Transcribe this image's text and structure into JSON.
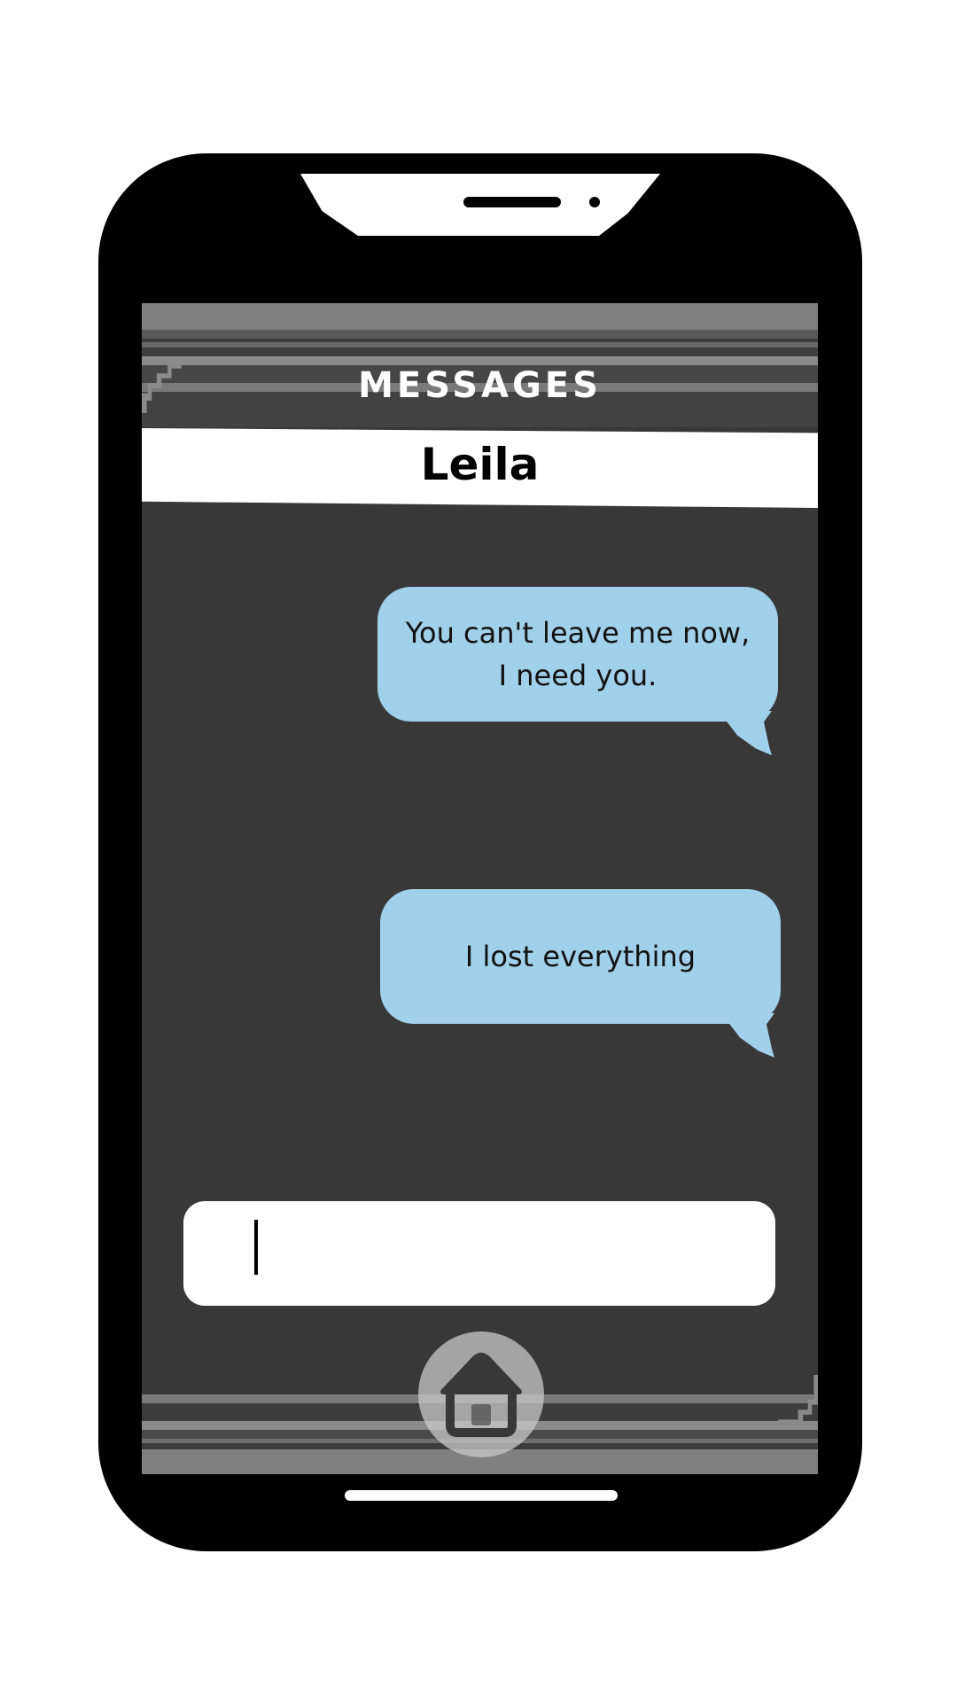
{
  "app": {
    "title": "MESSAGES"
  },
  "conversation": {
    "contact_name": "Leila",
    "messages": [
      {
        "text": "You can't leave me now,\nI need you."
      },
      {
        "text": "I lost everything"
      }
    ]
  },
  "composer": {
    "value": ""
  },
  "icons": {
    "home": "home-icon"
  },
  "colors": {
    "bubble": "#a0d0ea",
    "screen_bg": "#383838",
    "frame": "#000000"
  }
}
